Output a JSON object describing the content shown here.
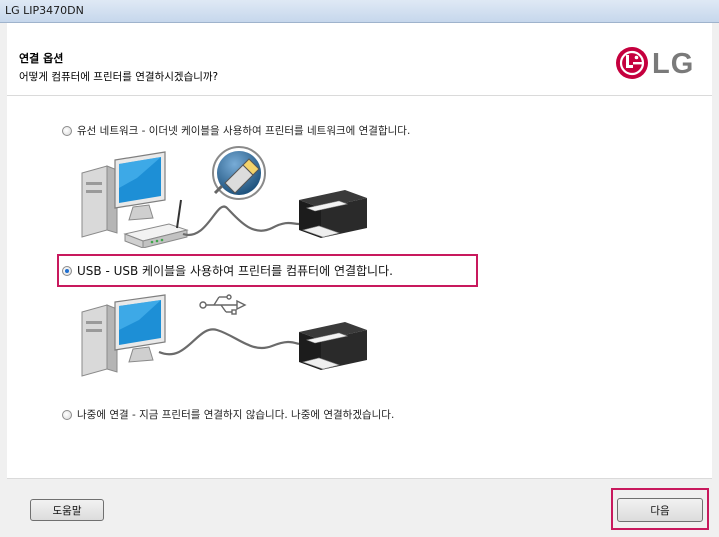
{
  "window": {
    "title": "LG LIP3470DN"
  },
  "header": {
    "title": "연결 옵션",
    "subtitle": "어떻게 컴퓨터에 프린터를 연결하시겠습니까?",
    "logo_text": "LG"
  },
  "options": [
    {
      "label": "유선 네트워크 - 이더넷 케이블을 사용하여 프린터를 네트워크에 연결합니다.",
      "selected": false
    },
    {
      "label": "USB - USB 케이블을 사용하여 프린터를 컴퓨터에 연결합니다.",
      "selected": true
    },
    {
      "label": "나중에 연결 - 지금 프린터를 연결하지 않습니다. 나중에 연결하겠습니다.",
      "selected": false
    }
  ],
  "footer": {
    "help_label": "도움말",
    "next_label": "다음"
  },
  "colors": {
    "highlight": "#c8195d",
    "lg_red": "#c5003e",
    "screen_blue": "#1d8fd6"
  },
  "icons": [
    "lg-logo-icon",
    "computer-icon",
    "router-icon",
    "ethernet-plug-icon",
    "printer-icon",
    "usb-symbol-icon"
  ]
}
